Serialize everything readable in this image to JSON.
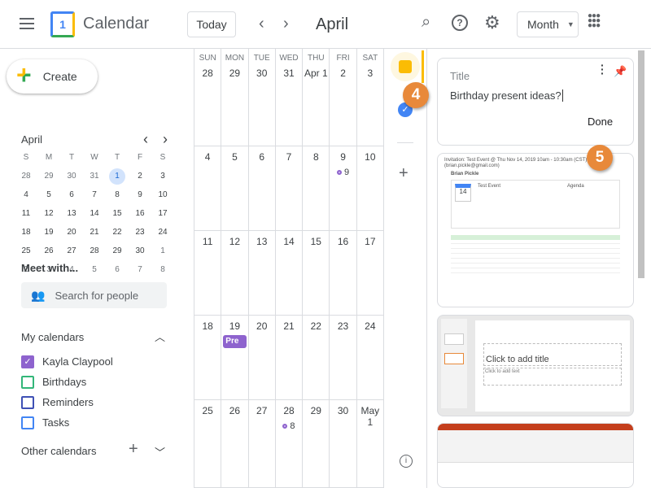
{
  "header": {
    "app_title": "Calendar",
    "today": "Today",
    "month": "April",
    "view": "Month"
  },
  "sidebar": {
    "create": "Create",
    "mini": {
      "month": "April",
      "dows": [
        "S",
        "M",
        "T",
        "W",
        "T",
        "F",
        "S"
      ],
      "days": [
        "28",
        "29",
        "30",
        "31",
        "1",
        "2",
        "3",
        "4",
        "5",
        "6",
        "7",
        "8",
        "9",
        "10",
        "11",
        "12",
        "13",
        "14",
        "15",
        "16",
        "17",
        "18",
        "19",
        "20",
        "21",
        "22",
        "23",
        "24",
        "25",
        "26",
        "27",
        "28",
        "29",
        "30",
        "1",
        "2",
        "3",
        "4",
        "5",
        "6",
        "7",
        "8"
      ],
      "selected": "1"
    },
    "meet_with": "Meet with...",
    "search_placeholder": "Search for people",
    "my_calendars": "My calendars",
    "calendars": [
      {
        "label": "Kayla Claypool",
        "color": "#8e63ce",
        "checked": true
      },
      {
        "label": "Birthdays",
        "color": "#33b679",
        "checked": false
      },
      {
        "label": "Reminders",
        "color": "#3f51b5",
        "checked": false
      },
      {
        "label": "Tasks",
        "color": "#4285f4",
        "checked": false
      }
    ],
    "other_calendars": "Other calendars"
  },
  "grid": {
    "dows": [
      "SUN",
      "MON",
      "TUE",
      "WED",
      "THU",
      "FRI",
      "SAT"
    ],
    "weeks": [
      [
        "28",
        "29",
        "30",
        "31",
        "Apr 1",
        "2",
        "3"
      ],
      [
        "4",
        "5",
        "6",
        "7",
        "8",
        "9",
        "10"
      ],
      [
        "11",
        "12",
        "13",
        "14",
        "15",
        "16",
        "17"
      ],
      [
        "18",
        "19",
        "20",
        "21",
        "22",
        "23",
        "24"
      ],
      [
        "25",
        "26",
        "27",
        "28",
        "29",
        "30",
        "May 1"
      ]
    ],
    "events": {
      "1-5": {
        "type": "dot",
        "label": "9"
      },
      "3-1": {
        "type": "chip",
        "label": "Pre"
      },
      "4-3": {
        "type": "dot",
        "label": "8"
      }
    }
  },
  "keep": {
    "note": {
      "title_placeholder": "Title",
      "body": "Birthday present ideas?",
      "done": "Done"
    },
    "email": {
      "subject": "Invitation: Test Event @ Thu Nov 14, 2019 10am - 10:30am (CST)",
      "from": "(brian.pickle@gmail.com)",
      "sender": "Brian Pickle",
      "event": "Test Event",
      "agenda": "Agenda",
      "day": "14"
    },
    "slide": {
      "title": "Click to add title",
      "text": "Click to add text"
    }
  },
  "callouts": [
    "4",
    "5"
  ]
}
